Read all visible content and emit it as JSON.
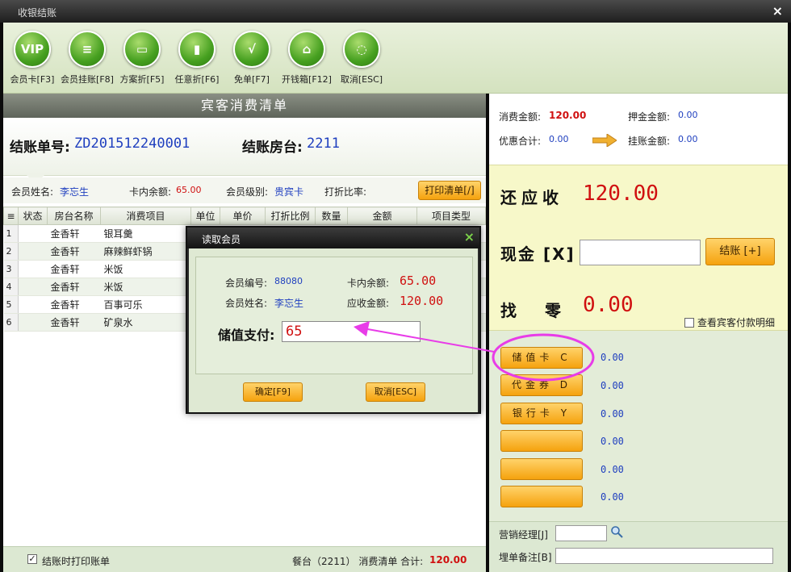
{
  "window": {
    "title": "收银结账",
    "close": "×"
  },
  "toolbar": {
    "buttons": [
      {
        "label": "会员卡[F3]",
        "glyph": "VIP"
      },
      {
        "label": "会员挂账[F8]",
        "glyph": "≡"
      },
      {
        "label": "方案折[F5]",
        "glyph": "▭"
      },
      {
        "label": "任意折[F6]",
        "glyph": "▮"
      },
      {
        "label": "免单[F7]",
        "glyph": "√"
      },
      {
        "label": "开钱箱[F12]",
        "glyph": "⌂"
      },
      {
        "label": "取消[ESC]",
        "glyph": "◌"
      }
    ]
  },
  "bill": {
    "header": "宾客消费清单",
    "bill_no_label": "结账单号:",
    "bill_no": "ZD201512240001",
    "room_label": "结账房台:",
    "room": "2211",
    "member_name_label": "会员姓名:",
    "member_name": "李忘生",
    "card_balance_label": "卡内余额:",
    "card_balance": "65.00",
    "member_level_label": "会员级别:",
    "member_level": "贵宾卡",
    "discount_label": "打折比率:",
    "print_button": "打印清单[/]",
    "columns": [
      "≡",
      "状态",
      "房台名称",
      "消费项目",
      "单位",
      "单价",
      "打折比例",
      "数量",
      "金额",
      "项目类型"
    ],
    "rows": [
      {
        "n": "1",
        "room": "金香轩",
        "item": "银耳羹"
      },
      {
        "n": "2",
        "room": "金香轩",
        "item": "麻辣鲜虾锅"
      },
      {
        "n": "3",
        "room": "金香轩",
        "item": "米饭"
      },
      {
        "n": "4",
        "room": "金香轩",
        "item": "米饭"
      },
      {
        "n": "5",
        "room": "金香轩",
        "item": "百事可乐"
      },
      {
        "n": "6",
        "room": "金香轩",
        "item": "矿泉水"
      }
    ],
    "status_print_label": "结账时打印账单",
    "status_check": "✓",
    "status_table": "餐台（2211） 消费清单 合计:",
    "status_total": "120.00"
  },
  "summary": {
    "consume_label": "消费金额:",
    "consume": "120.00",
    "deposit_label": "押金金额:",
    "deposit": "0.00",
    "discount_label": "优惠合计:",
    "discount": "0.00",
    "credit_label": "挂账金额:",
    "credit": "0.00"
  },
  "due": {
    "due_label": "还应收",
    "due": "120.00",
    "cash_label": "现金 [X]",
    "settle_button": "结账 [+]",
    "change_label": "找 零",
    "change": "0.00",
    "view_detail": "查看宾客付款明细"
  },
  "payments": [
    {
      "label": "储值卡 C",
      "amount": "0.00"
    },
    {
      "label": "代金券 D",
      "amount": "0.00"
    },
    {
      "label": "银行卡 Y",
      "amount": "0.00"
    },
    {
      "label": "",
      "amount": "0.00"
    },
    {
      "label": "",
      "amount": "0.00"
    },
    {
      "label": "",
      "amount": "0.00"
    }
  ],
  "footer": {
    "manager_label": "营销经理[J]",
    "remark_label": "埋单备注[B]"
  },
  "dialog": {
    "title": "读取会员",
    "close": "×",
    "member_no_label": "会员编号:",
    "member_no": "88080",
    "balance_label": "卡内余额:",
    "balance": "65.00",
    "name_label": "会员姓名:",
    "name": "李忘生",
    "due_label": "应收金额:",
    "due": "120.00",
    "stored_label": "储值支付:",
    "stored_value": "65",
    "ok_button": "确定[F9]",
    "cancel_button": "取消[ESC]"
  },
  "colors": {
    "accent_orange": "#f5a20e",
    "annotation_magenta": "#e83ce8",
    "value_red": "#d01010",
    "value_blue": "#1f3fbf"
  }
}
